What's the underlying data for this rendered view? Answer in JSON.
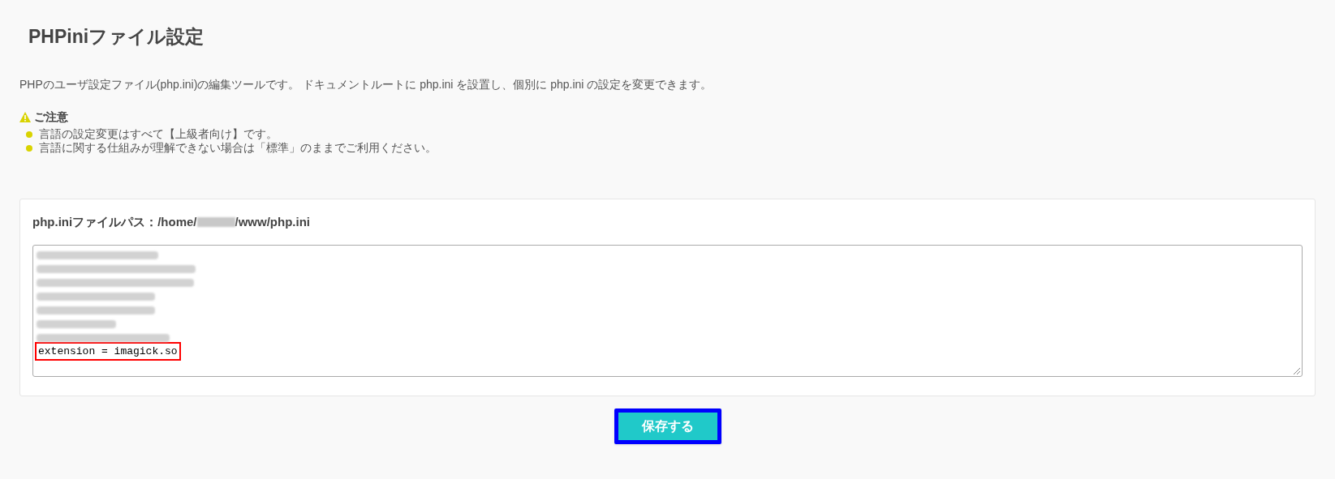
{
  "title": "PHPiniファイル設定",
  "description": "PHPのユーザ設定ファイル(php.ini)の編集ツールです。 ドキュメントルートに php.ini を設置し、個別に php.ini の設定を変更できます。",
  "notice": {
    "heading": "ご注意",
    "items": [
      "言語の設定変更はすべて【上級者向け】です。",
      "言語に関する仕組みが理解できない場合は「標準」のままでご利用ください。"
    ]
  },
  "editor": {
    "path_prefix": "php.iniファイルパス：/home/",
    "path_redacted": true,
    "path_suffix": "/www/php.ini",
    "lines": [
      {
        "kind": "redacted",
        "highlighted": false
      },
      {
        "kind": "redacted",
        "highlighted": false
      },
      {
        "kind": "redacted",
        "highlighted": false
      },
      {
        "kind": "redacted",
        "highlighted": false
      },
      {
        "kind": "redacted",
        "highlighted": false
      },
      {
        "kind": "redacted",
        "highlighted": false
      },
      {
        "kind": "redacted",
        "highlighted": false
      },
      {
        "kind": "text",
        "text": "extension = imagick.so",
        "highlighted": true
      }
    ]
  },
  "save_button": {
    "label": "保存する",
    "highlighted": true
  }
}
